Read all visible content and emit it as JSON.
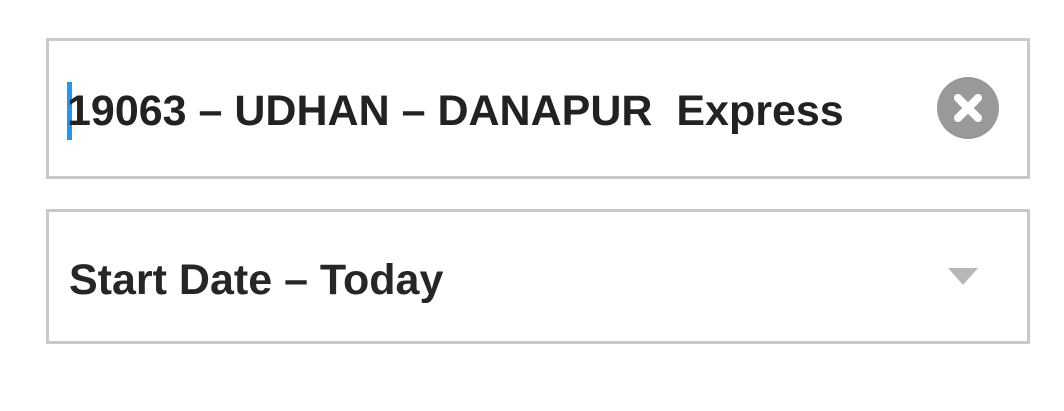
{
  "train_search": {
    "value": "19063 – UDHAN – DANAPUR  Express",
    "clear_icon": "close-circle-icon"
  },
  "start_date": {
    "label": "Start Date – Today",
    "arrow_icon": "dropdown-arrow-icon"
  },
  "colors": {
    "border": "#c9c9c9",
    "caret": "#2196f3",
    "clear_button": "#999999",
    "text": "#222222",
    "arrow": "#b7b7b7"
  }
}
